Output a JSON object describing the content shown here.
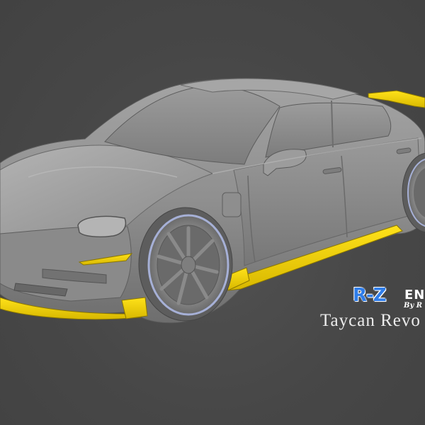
{
  "logo": {
    "mark": "R-Z",
    "word": "EN",
    "sub": "By R"
  },
  "title": "Taycan Revo",
  "colors": {
    "background": "#474747",
    "body": "#8d8d8d",
    "accent_parts": "#f2d200",
    "logo_blue": "#2f7de9"
  }
}
